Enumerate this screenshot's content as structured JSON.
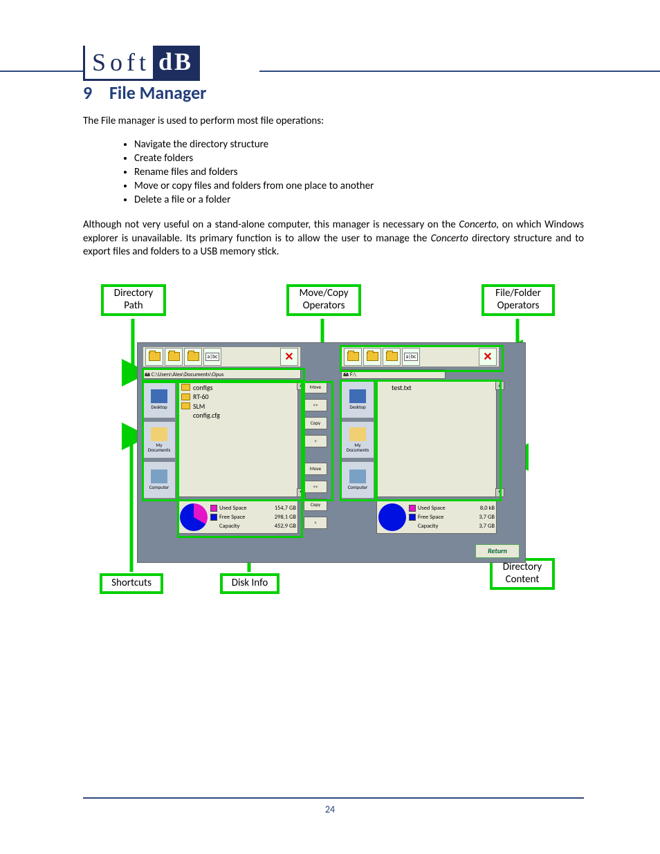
{
  "logo": {
    "left": "Soft",
    "right": "dB"
  },
  "heading": {
    "num": "9",
    "title": "File Manager"
  },
  "intro": "The File manager is used to perform most file operations:",
  "bullets": [
    "Navigate the directory structure",
    "Create folders",
    "Rename files and folders",
    "Move or copy files and folders from one place to another",
    "Delete a file or a folder"
  ],
  "para_pre": "Although not very useful on a stand-alone computer, this manager is necessary on the ",
  "para_i1": "Concerto,",
  "para_mid": " on which Windows explorer is unavailable. Its primary function is to allow the user to manage the ",
  "para_i2": "Concerto",
  "para_post": " directory structure and to export files and folders to a USB memory stick.",
  "labels": {
    "dirpath": "Directory\nPath",
    "movecopy": "Move/Copy\nOperators",
    "ffops": "File/Folder\nOperators",
    "shortcuts": "Shortcuts",
    "diskinfo": "Disk Info",
    "dircontent": "Directory\nContent"
  },
  "shortcuts": [
    "Desktop",
    "My\nDocuments",
    "Computer"
  ],
  "path_left": "C:\\Users\\Alex\\Documents\\Opus",
  "path_right": "F:\\",
  "list_left": [
    {
      "type": "folder",
      "name": "configs"
    },
    {
      "type": "folder",
      "name": "RT-60"
    },
    {
      "type": "folder",
      "name": "SLM"
    },
    {
      "type": "file",
      "name": "config.cfg"
    }
  ],
  "list_right": [
    {
      "type": "file",
      "name": "test.txt"
    }
  ],
  "ops": [
    "Move",
    ">>",
    "Copy",
    ">",
    "Move",
    "<<",
    "Copy",
    "<"
  ],
  "rename": "a|bc",
  "disk_left": {
    "rows": [
      {
        "swatch": "u",
        "label": "Used Space",
        "val": "154,7 GB"
      },
      {
        "swatch": "f",
        "label": "Free Space",
        "val": "298,1 GB"
      },
      {
        "swatch": "",
        "label": "Capacity",
        "val": "452,9 GB"
      }
    ]
  },
  "disk_right": {
    "rows": [
      {
        "swatch": "u",
        "label": "Used Space",
        "val": "8,0 kB"
      },
      {
        "swatch": "f",
        "label": "Free Space",
        "val": "3,7 GB"
      },
      {
        "swatch": "",
        "label": "Capacity",
        "val": "3,7 GB"
      }
    ]
  },
  "return": "Return",
  "page": "24"
}
